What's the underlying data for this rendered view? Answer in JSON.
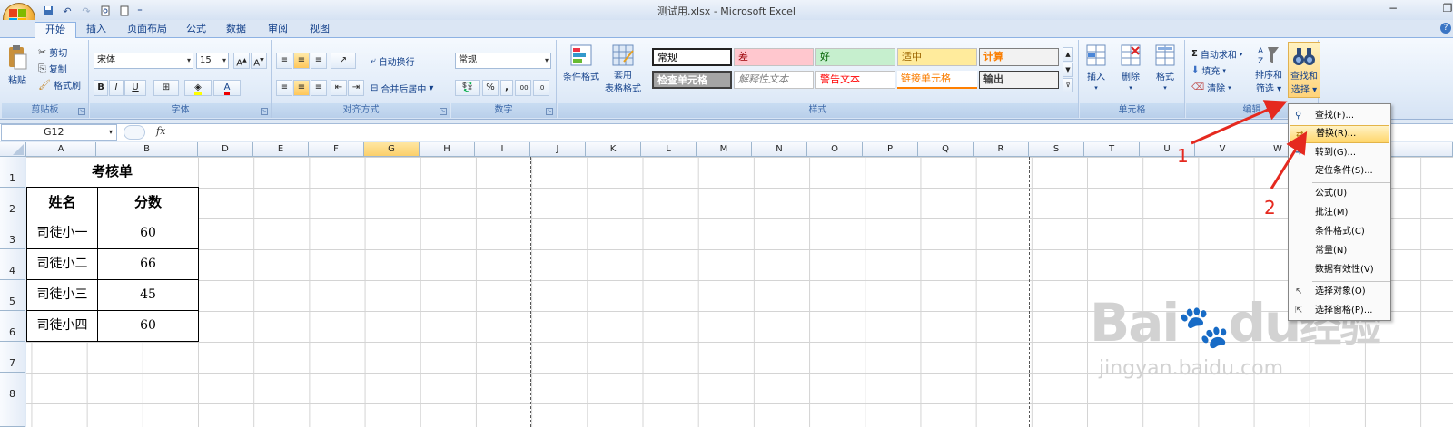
{
  "window": {
    "title": "测试用.xlsx - Microsoft Excel"
  },
  "tabs": [
    "开始",
    "插入",
    "页面布局",
    "公式",
    "数据",
    "审阅",
    "视图"
  ],
  "ribbon": {
    "clipboard": {
      "label": "剪贴板",
      "paste": "粘贴",
      "cut": "剪切",
      "copy": "复制",
      "format_painter": "格式刷"
    },
    "font": {
      "label": "字体",
      "name": "宋体",
      "size": "15",
      "bold": "B",
      "italic": "I",
      "underline": "U"
    },
    "alignment": {
      "label": "对齐方式",
      "wrap": "自动换行",
      "merge": "合并后居中"
    },
    "number": {
      "label": "数字",
      "format": "常规",
      "percent": "%",
      "comma": ","
    },
    "styles": {
      "label": "样式",
      "conditional": "条件格式",
      "table_line1": "套用",
      "table_line2": "表格格式",
      "cells": [
        {
          "text": "常规"
        },
        {
          "text": "差"
        },
        {
          "text": "好"
        },
        {
          "text": "适中"
        },
        {
          "text": "计算"
        },
        {
          "text": "检查单元格"
        },
        {
          "text": "解释性文本"
        },
        {
          "text": "警告文本"
        },
        {
          "text": "链接单元格"
        },
        {
          "text": "输出"
        }
      ]
    },
    "cells_group": {
      "label": "单元格",
      "insert": "插入",
      "delete": "删除",
      "format": "格式"
    },
    "editing": {
      "label": "编辑",
      "autosum": "自动求和",
      "fill": "填充",
      "clear": "清除",
      "sort_line1": "排序和",
      "sort_line2": "筛选",
      "find_line1": "查找和",
      "find_line2": "选择"
    }
  },
  "formula_bar": {
    "name_box": "G12",
    "fx": "fx",
    "value": ""
  },
  "columns": [
    "A",
    "B",
    "D",
    "E",
    "F",
    "G",
    "H",
    "I",
    "J",
    "K",
    "L",
    "M",
    "N",
    "O",
    "P",
    "Q",
    "R",
    "S",
    "T",
    "U",
    "V",
    "W"
  ],
  "rows": [
    "1",
    "2",
    "3",
    "4",
    "5",
    "6",
    "7",
    "8"
  ],
  "sheet": {
    "title": "考核单",
    "headers": [
      "姓名",
      "分数"
    ],
    "records": [
      {
        "name": "司徒小一",
        "score": "60"
      },
      {
        "name": "司徒小二",
        "score": "66"
      },
      {
        "name": "司徒小三",
        "score": "45"
      },
      {
        "name": "司徒小四",
        "score": "60"
      }
    ]
  },
  "dropdown": {
    "items": [
      {
        "label": "查找(F)..."
      },
      {
        "label": "替换(R)..."
      },
      {
        "label": "转到(G)..."
      },
      {
        "label": "定位条件(S)..."
      },
      {
        "label": "公式(U)"
      },
      {
        "label": "批注(M)"
      },
      {
        "label": "条件格式(C)"
      },
      {
        "label": "常量(N)"
      },
      {
        "label": "数据有效性(V)"
      },
      {
        "label": "选择对象(O)"
      },
      {
        "label": "选择窗格(P)..."
      }
    ]
  },
  "annotations": {
    "step1": "1",
    "step2": "2"
  },
  "watermark": {
    "brand": "Bai",
    "brand2": "du",
    "brand3": "经验",
    "url": "jingyan.baidu.com"
  }
}
